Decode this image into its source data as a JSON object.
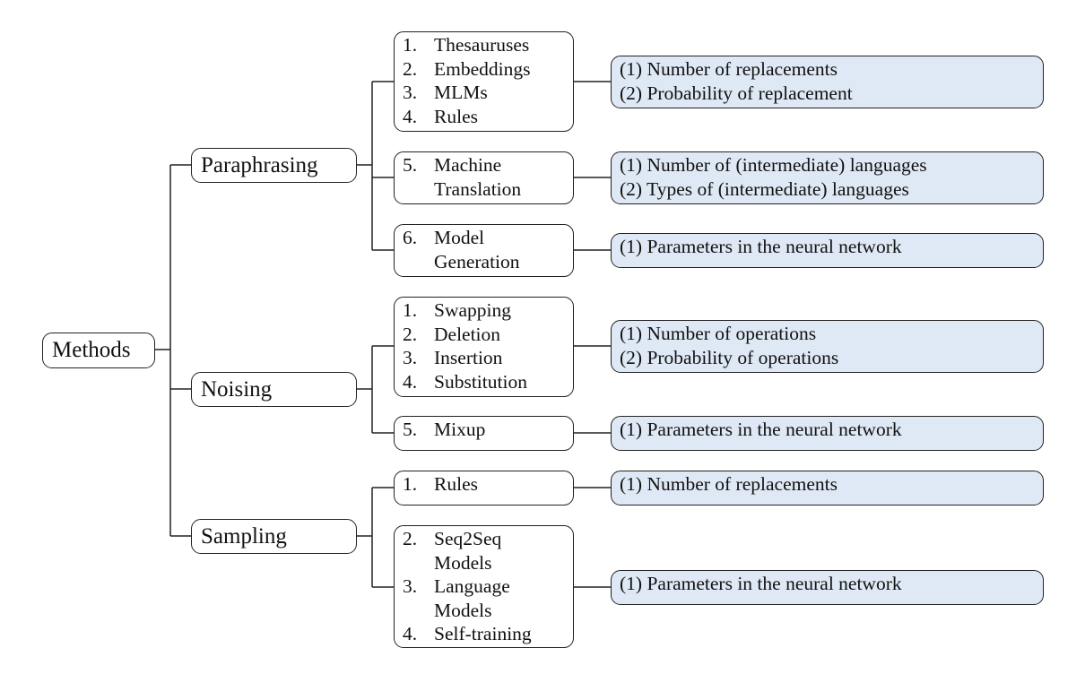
{
  "diagram": {
    "root": {
      "label": "Methods"
    },
    "categories": [
      {
        "label": "Paraphrasing",
        "groups": [
          {
            "items": [
              {
                "num": "1.",
                "label": "Thesauruses"
              },
              {
                "num": "2.",
                "label": "Embeddings"
              },
              {
                "num": "3.",
                "label": "MLMs"
              },
              {
                "num": "4.",
                "label": "Rules"
              }
            ],
            "params": [
              "(1) Number of replacements",
              "(2) Probability of replacement"
            ]
          },
          {
            "items": [
              {
                "num": "5.",
                "label": "Machine\nTranslation"
              }
            ],
            "params": [
              "(1) Number of (intermediate) languages",
              "(2) Types of (intermediate) languages"
            ]
          },
          {
            "items": [
              {
                "num": "6.",
                "label": "Model\nGeneration"
              }
            ],
            "params": [
              "(1) Parameters in the neural network"
            ]
          }
        ]
      },
      {
        "label": "Noising",
        "groups": [
          {
            "items": [
              {
                "num": "1.",
                "label": "Swapping"
              },
              {
                "num": "2.",
                "label": "Deletion"
              },
              {
                "num": "3.",
                "label": "Insertion"
              },
              {
                "num": "4.",
                "label": "Substitution"
              }
            ],
            "params": [
              "(1) Number of operations",
              "(2) Probability of operations"
            ]
          },
          {
            "items": [
              {
                "num": "5.",
                "label": "Mixup"
              }
            ],
            "params": [
              "(1) Parameters in the neural network"
            ]
          }
        ]
      },
      {
        "label": "Sampling",
        "groups": [
          {
            "items": [
              {
                "num": "1.",
                "label": "Rules"
              }
            ],
            "params": [
              "(1) Number of replacements"
            ]
          },
          {
            "items": [
              {
                "num": "2.",
                "label": "Seq2Seq\nModels"
              },
              {
                "num": "3.",
                "label": "Language\nModels"
              },
              {
                "num": "4.",
                "label": "Self-training"
              }
            ],
            "params": [
              "(1) Parameters in the neural network"
            ]
          }
        ]
      }
    ],
    "colors": {
      "param_fill": "#dfe9f5",
      "stroke": "#222222",
      "node_fill": "#ffffff"
    }
  }
}
